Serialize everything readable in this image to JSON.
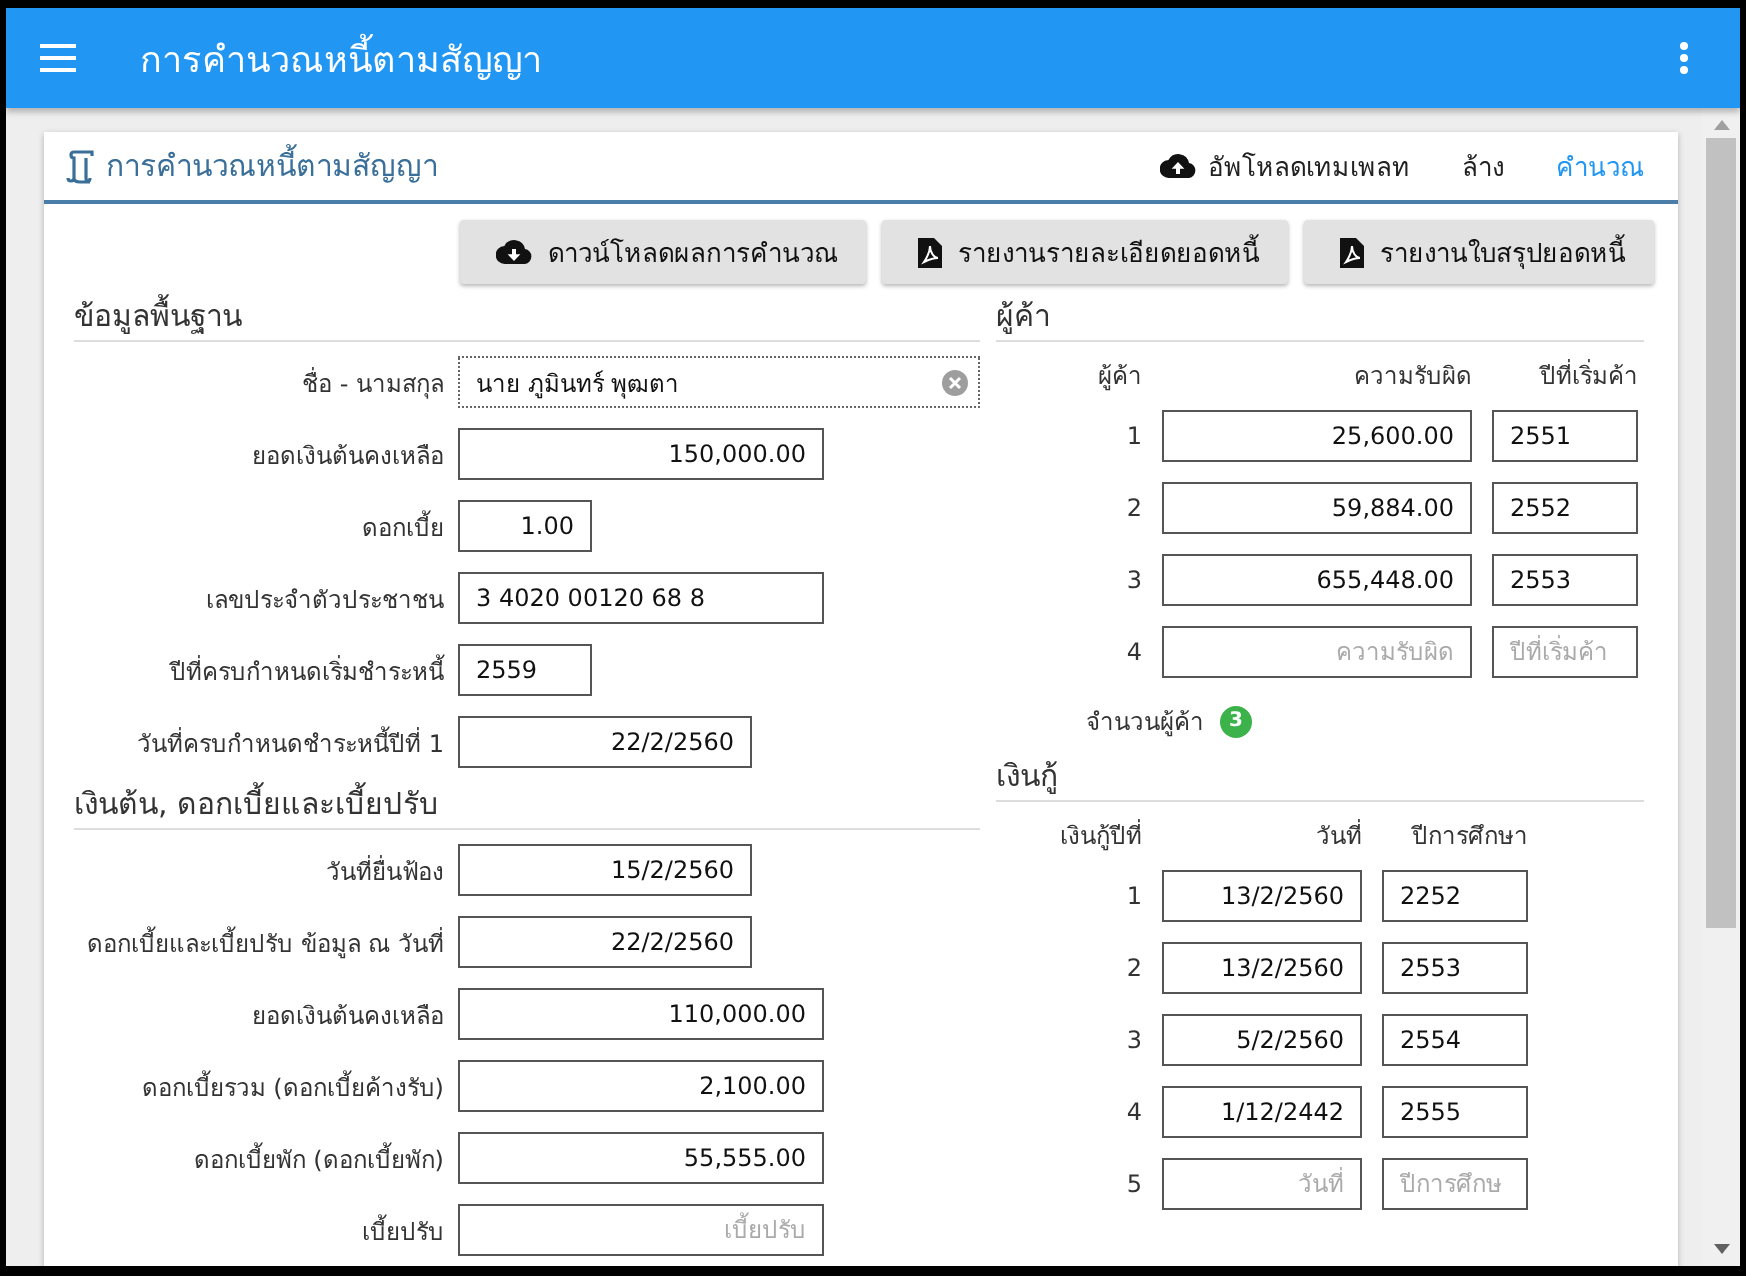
{
  "app_bar": {
    "title": "การคำนวณหนี้ตามสัญญา"
  },
  "card": {
    "title": "การคำนวณหนี้ตามสัญญา",
    "actions": [
      {
        "label": "อัพโหลดเทมเพลท",
        "kind": "upload"
      },
      {
        "label": "ล้าง",
        "kind": "plain"
      },
      {
        "label": "คำนวณ",
        "kind": "primary"
      }
    ]
  },
  "buttons": [
    {
      "label": "ดาวน์โหลดผลการคำนวณ",
      "kind": "download"
    },
    {
      "label": "รายงานรายละเอียดยอดหนี้",
      "kind": "pdf"
    },
    {
      "label": "รายงานใบสรุปยอดหนี้",
      "kind": "pdf"
    }
  ],
  "basic": {
    "heading": "ข้อมูลพื้นฐาน",
    "fields": [
      {
        "label": "ชื่อ - นามสกุล",
        "value": "นาย ภูมินทร์ พุฒตา",
        "kind": "clearable"
      },
      {
        "label": "ยอดเงินต้นคงเหลือ",
        "value": "150,000.00",
        "kind": "text"
      },
      {
        "label": "ดอกเบี้ย",
        "value": "1.00",
        "kind": "text"
      },
      {
        "label": "เลขประจำตัวประชาชน",
        "value": "3 4020 00120 68 8",
        "kind": "text"
      },
      {
        "label": "ปีที่ครบกำหนดเริ่มชำระหนี้",
        "value": "2559",
        "kind": "text"
      },
      {
        "label": "วันที่ครบกำหนดชำระหนี้ปีที่ 1",
        "value": "22/2/2560",
        "kind": "text"
      }
    ]
  },
  "principal": {
    "heading": "เงินต้น, ดอกเบี้ยและเบี้ยปรับ",
    "fields": [
      {
        "label": "วันที่ยื่นฟ้อง",
        "value": "15/2/2560",
        "kind": "text"
      },
      {
        "label": "ดอกเบี้ยและเบี้ยปรับ ข้อมูล ณ วันที่",
        "value": "22/2/2560",
        "kind": "text"
      },
      {
        "label": "ยอดเงินต้นคงเหลือ",
        "value": "110,000.00",
        "kind": "text"
      },
      {
        "label": "ดอกเบี้ยรวม (ดอกเบี้ยค้างรับ)",
        "value": "2,100.00",
        "kind": "text"
      },
      {
        "label": "ดอกเบี้ยพัก (ดอกเบี้ยพัก)",
        "value": "55,555.00",
        "kind": "text"
      },
      {
        "label": "เบี้ยปรับ",
        "placeholder": "เบี้ยปรับ",
        "kind": "text"
      }
    ]
  },
  "debtors": {
    "heading": "ผู้ค้า",
    "columns": [
      "ผู้ค้า",
      "ความรับผิด",
      "ปีที่เริ่มค้า"
    ],
    "rows": [
      {
        "cells": [
          {
            "kind": "number",
            "value": "1"
          },
          {
            "kind": "input",
            "value": "25,600.00"
          },
          {
            "kind": "input",
            "value": "2551"
          }
        ]
      },
      {
        "cells": [
          {
            "kind": "number",
            "value": "2"
          },
          {
            "kind": "input",
            "value": "59,884.00"
          },
          {
            "kind": "input",
            "value": "2552"
          }
        ]
      },
      {
        "cells": [
          {
            "kind": "number",
            "value": "3"
          },
          {
            "kind": "input",
            "value": "655,448.00"
          },
          {
            "kind": "input",
            "value": "2553"
          }
        ]
      },
      {
        "cells": [
          {
            "kind": "number",
            "value": "4"
          },
          {
            "kind": "input",
            "placeholder": "ความรับผิด"
          },
          {
            "kind": "input",
            "placeholder": "ปีที่เริ่มค้า"
          }
        ]
      }
    ],
    "count_label": "จำนวนผู้ค้า",
    "count": "3"
  },
  "loans": {
    "heading": "เงินกู้",
    "columns": [
      "เงินกู้ปีที่",
      "วันที่",
      "ปีการศึกษา"
    ],
    "rows": [
      {
        "cells": [
          {
            "kind": "number",
            "value": "1"
          },
          {
            "kind": "input",
            "value": "13/2/2560"
          },
          {
            "kind": "input",
            "value": "2252"
          }
        ]
      },
      {
        "cells": [
          {
            "kind": "number",
            "value": "2"
          },
          {
            "kind": "input",
            "value": "13/2/2560"
          },
          {
            "kind": "input",
            "value": "2553"
          }
        ]
      },
      {
        "cells": [
          {
            "kind": "number",
            "value": "3"
          },
          {
            "kind": "input",
            "value": "5/2/2560"
          },
          {
            "kind": "input",
            "value": "2554"
          }
        ]
      },
      {
        "cells": [
          {
            "kind": "number",
            "value": "4"
          },
          {
            "kind": "input",
            "value": "1/12/2442"
          },
          {
            "kind": "input",
            "value": "2555"
          }
        ]
      },
      {
        "cells": [
          {
            "kind": "number",
            "value": "5"
          },
          {
            "kind": "input",
            "placeholder": "วันที่"
          },
          {
            "kind": "input",
            "placeholder": "ปีการศึกษ"
          }
        ]
      }
    ]
  }
}
